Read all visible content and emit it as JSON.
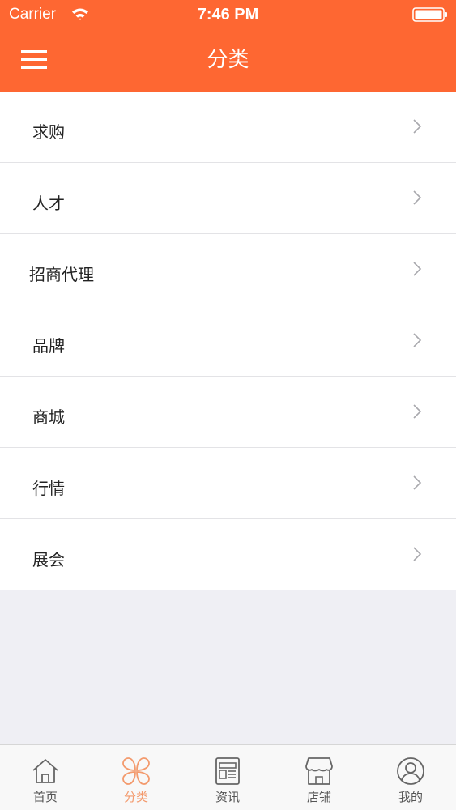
{
  "status_bar": {
    "carrier": "Carrier",
    "time": "7:46 PM"
  },
  "nav": {
    "title": "分类",
    "menu_icon": "hamburger-menu-icon"
  },
  "categories": [
    {
      "label": "求购"
    },
    {
      "label": "人才"
    },
    {
      "label": "招商代理"
    },
    {
      "label": "品牌"
    },
    {
      "label": "商城"
    },
    {
      "label": "行情"
    },
    {
      "label": "展会"
    }
  ],
  "tabs": [
    {
      "label": "首页",
      "icon": "home-icon",
      "active": false
    },
    {
      "label": "分类",
      "icon": "category-icon",
      "active": true
    },
    {
      "label": "资讯",
      "icon": "news-icon",
      "active": false
    },
    {
      "label": "店铺",
      "icon": "store-icon",
      "active": false
    },
    {
      "label": "我的",
      "icon": "profile-icon",
      "active": false
    }
  ],
  "colors": {
    "accent": "#fe6732",
    "active_tab": "#f39a6d",
    "background": "#efeff4"
  }
}
